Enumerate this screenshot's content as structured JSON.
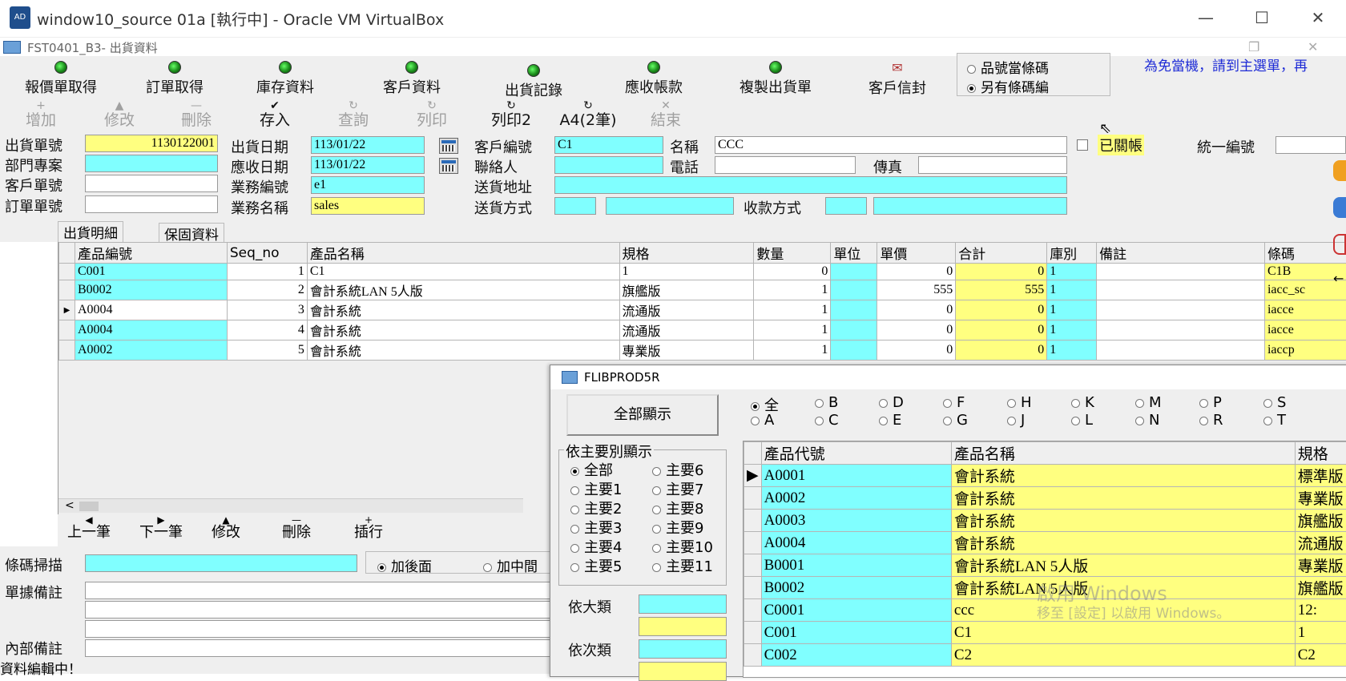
{
  "window": {
    "title": "window10_source 01a [執行中] - Oracle VM VirtualBox",
    "logo_text": "AD"
  },
  "app": {
    "title": "FST0401_B3- 出貨資料"
  },
  "toolbar1": [
    {
      "label": "報價單取得"
    },
    {
      "label": "訂單取得"
    },
    {
      "label": "庫存資料"
    },
    {
      "label": "客戶資料"
    },
    {
      "label": "出貨記錄"
    },
    {
      "label": "應收帳款"
    },
    {
      "label": "複製出貨單"
    },
    {
      "label": "客戶信封"
    }
  ],
  "barcode_mode": {
    "options": [
      "品號當條碼",
      "另有條碼編"
    ],
    "selected": "另有條碼編"
  },
  "notice": "為免當機，請到主選單，再",
  "toolbar2": [
    {
      "glyph": "+",
      "label": "增加",
      "enabled": false
    },
    {
      "glyph": "▲",
      "label": "修改",
      "enabled": false
    },
    {
      "glyph": "—",
      "label": "刪除",
      "enabled": false
    },
    {
      "glyph": "✔",
      "label": "存入",
      "enabled": true
    },
    {
      "glyph": "↻",
      "label": "查詢",
      "enabled": false
    },
    {
      "glyph": "↻",
      "label": "列印",
      "enabled": false
    },
    {
      "glyph": "↻",
      "label": "列印2",
      "enabled": true
    },
    {
      "glyph": "↻",
      "label": "A4(2筆)",
      "enabled": true
    },
    {
      "glyph": "✕",
      "label": "結束",
      "enabled": false
    }
  ],
  "form": {
    "ship_no_label": "出貨單號",
    "ship_no": "1130122001",
    "dept_label": "部門專案",
    "dept": "",
    "cust_order_label": "客戶單號",
    "cust_order": "",
    "order_no_label": "訂單單號",
    "order_no": "",
    "ship_date_label": "出貨日期",
    "ship_date": "113/01/22",
    "due_date_label": "應收日期",
    "due_date": "113/01/22",
    "sales_no_label": "業務編號",
    "sales_no": "e1",
    "sales_name_label": "業務名稱",
    "sales_name": "sales",
    "cust_no_label": "客戶編號",
    "cust_no": "C1",
    "name_label": "名稱",
    "name": "CCC",
    "contact_label": "聯絡人",
    "contact": "",
    "phone_label": "電話",
    "phone": "",
    "fax_label": "傳真",
    "fax": "",
    "addr_label": "送貨地址",
    "addr": "",
    "ship_method_label": "送貨方式",
    "pay_method_label": "收款方式",
    "closed_label": "已關帳",
    "tax_id_label": "統一編號"
  },
  "tabs": [
    "出貨明細",
    "保固資料"
  ],
  "grid": {
    "columns": [
      "產品編號",
      "Seq_no",
      "產品名稱",
      "規格",
      "數量",
      "單位",
      "單價",
      "合計",
      "庫別",
      "備註",
      "條碼"
    ],
    "rows": [
      [
        "C001",
        "1",
        "C1",
        "1",
        "0",
        "",
        "0",
        "0",
        "1",
        "",
        "C1B"
      ],
      [
        "B0002",
        "2",
        "會計系統LAN 5人版",
        "旗艦版",
        "1",
        "",
        "555",
        "555",
        "1",
        "",
        "iacc_sc"
      ],
      [
        "A0004",
        "3",
        "會計系統",
        "流通版",
        "1",
        "",
        "0",
        "0",
        "1",
        "",
        "iacce"
      ],
      [
        "A0004",
        "4",
        "會計系統",
        "流通版",
        "1",
        "",
        "0",
        "0",
        "1",
        "",
        "iacce"
      ],
      [
        "A0002",
        "5",
        "會計系統",
        "專業版",
        "1",
        "",
        "0",
        "0",
        "1",
        "",
        "iaccp"
      ]
    ],
    "current_row": 2,
    "scroll_left": "<"
  },
  "navbar": [
    {
      "glyph": "◀",
      "label": "上一筆"
    },
    {
      "glyph": "▶",
      "label": "下一筆"
    },
    {
      "glyph": "▲",
      "label": "修改"
    },
    {
      "glyph": "—",
      "label": "刪除"
    },
    {
      "glyph": "+",
      "label": "插行"
    }
  ],
  "bottom": {
    "scan_label": "條碼掃描",
    "append_options": [
      "加後面",
      "加中間"
    ],
    "append_selected": "加後面",
    "note_label": "單據備註",
    "internal_label": "內部備註"
  },
  "status": "資料編輯中！",
  "popup": {
    "title": "FLIBPROD5R",
    "show_all": "全部顯示",
    "letters_top": [
      "全",
      "B",
      "D",
      "F",
      "H",
      "K",
      "M",
      "P",
      "S"
    ],
    "letters_bottom": [
      "A",
      "C",
      "E",
      "G",
      "J",
      "L",
      "N",
      "R",
      "T"
    ],
    "letter_selected": "全",
    "group_title": "依主要別顯示",
    "group_left": [
      "全部",
      "主要1",
      "主要2",
      "主要3",
      "主要4",
      "主要5"
    ],
    "group_right": [
      "主要6",
      "主要7",
      "主要8",
      "主要9",
      "主要10",
      "主要11"
    ],
    "group_selected": "全部",
    "big_cat_label": "依大類",
    "sub_cat_label": "依次類",
    "columns": [
      "產品代號",
      "產品名稱",
      "規格"
    ],
    "rows": [
      [
        "A0001",
        "會計系統",
        "標準版"
      ],
      [
        "A0002",
        "會計系統",
        "專業版"
      ],
      [
        "A0003",
        "會計系統",
        "旗艦版"
      ],
      [
        "A0004",
        "會計系統",
        "流通版"
      ],
      [
        "B0001",
        "會計系統LAN 5人版",
        "專業版"
      ],
      [
        "B0002",
        "會計系統LAN 5人版",
        "旗艦版"
      ],
      [
        "C0001",
        "ccc",
        "12:"
      ],
      [
        "C001",
        "C1",
        "1"
      ],
      [
        "C002",
        "C2",
        "C2"
      ]
    ]
  },
  "watermark": {
    "line1": "啟用 Windows",
    "line2": "移至 [設定] 以啟用 Windows。"
  },
  "colors": {
    "cyan": "#80ffff",
    "yellow": "#ffff80",
    "notice": "#1e2bd6",
    "panel": "#efefef"
  }
}
